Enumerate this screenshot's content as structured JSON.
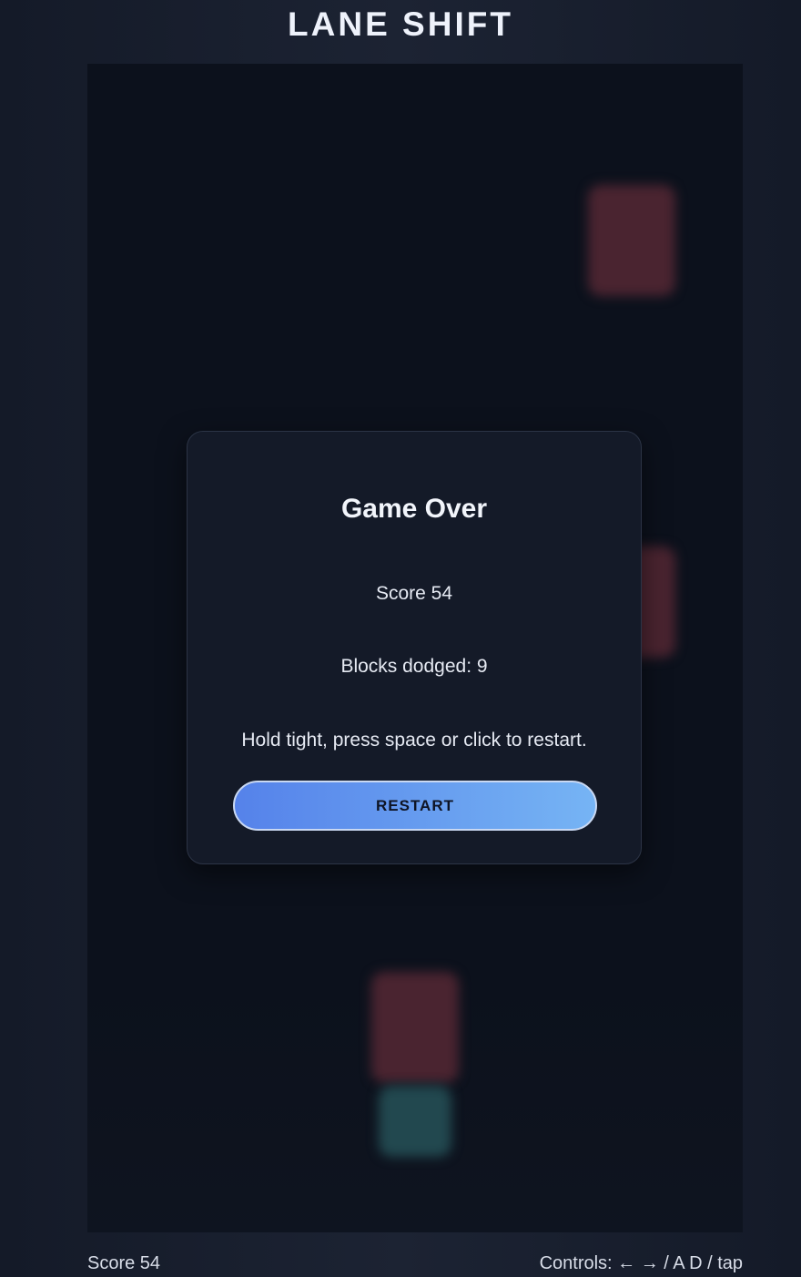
{
  "header": {
    "title": "LANE SHIFT"
  },
  "overlay": {
    "title": "Game Over",
    "score_text": "Score 54",
    "dodged_text": "Blocks dodged: 9",
    "hint": "Hold tight, press space or click to restart.",
    "restart_label": "RESTART"
  },
  "footer": {
    "score": "Score 54",
    "controls": "Controls: ← → / A D / tap"
  },
  "colors": {
    "enemy_block": "#4a2430",
    "player_block": "#22484f",
    "button_start": "#5582ea",
    "button_end": "#76b4f4"
  }
}
